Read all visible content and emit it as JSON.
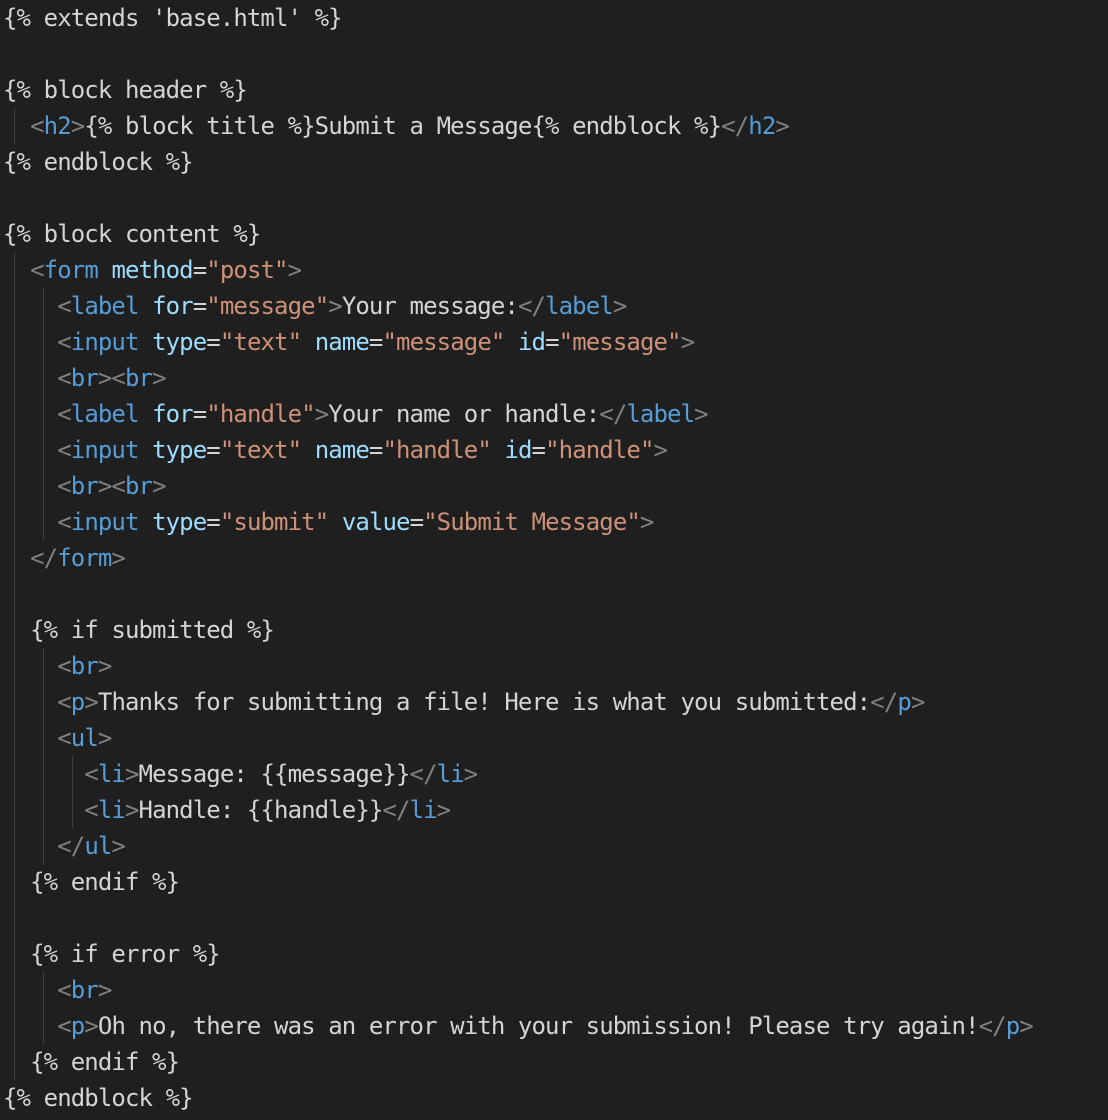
{
  "editor": {
    "colors": {
      "background": "#1f1f1f",
      "text": "#d4d4d4",
      "bracket": "#808080",
      "tag": "#569cd6",
      "attribute": "#9cdcfe",
      "string": "#ce9178",
      "indent_guide": "#3f3f3f"
    },
    "lines": [
      [
        {
          "t": "{% extends 'base.html' %}",
          "k": "text"
        }
      ],
      [],
      [
        {
          "t": "{% block header %}",
          "k": "text"
        }
      ],
      [
        {
          "t": "  ",
          "k": "text"
        },
        {
          "t": "<",
          "k": "bracket"
        },
        {
          "t": "h2",
          "k": "tag"
        },
        {
          "t": ">",
          "k": "bracket"
        },
        {
          "t": "{% block title %}Submit a Message{% endblock %}",
          "k": "text"
        },
        {
          "t": "</",
          "k": "bracket"
        },
        {
          "t": "h2",
          "k": "tag"
        },
        {
          "t": ">",
          "k": "bracket"
        }
      ],
      [
        {
          "t": "{% endblock %}",
          "k": "text"
        }
      ],
      [],
      [
        {
          "t": "{% block content %}",
          "k": "text"
        }
      ],
      [
        {
          "t": "  ",
          "k": "text"
        },
        {
          "t": "<",
          "k": "bracket"
        },
        {
          "t": "form",
          "k": "tag"
        },
        {
          "t": " ",
          "k": "text"
        },
        {
          "t": "method",
          "k": "attr"
        },
        {
          "t": "=",
          "k": "text"
        },
        {
          "t": "\"post\"",
          "k": "string"
        },
        {
          "t": ">",
          "k": "bracket"
        }
      ],
      [
        {
          "t": "    ",
          "k": "text"
        },
        {
          "t": "<",
          "k": "bracket"
        },
        {
          "t": "label",
          "k": "tag"
        },
        {
          "t": " ",
          "k": "text"
        },
        {
          "t": "for",
          "k": "attr"
        },
        {
          "t": "=",
          "k": "text"
        },
        {
          "t": "\"message\"",
          "k": "string"
        },
        {
          "t": ">",
          "k": "bracket"
        },
        {
          "t": "Your message:",
          "k": "text"
        },
        {
          "t": "</",
          "k": "bracket"
        },
        {
          "t": "label",
          "k": "tag"
        },
        {
          "t": ">",
          "k": "bracket"
        }
      ],
      [
        {
          "t": "    ",
          "k": "text"
        },
        {
          "t": "<",
          "k": "bracket"
        },
        {
          "t": "input",
          "k": "tag"
        },
        {
          "t": " ",
          "k": "text"
        },
        {
          "t": "type",
          "k": "attr"
        },
        {
          "t": "=",
          "k": "text"
        },
        {
          "t": "\"text\"",
          "k": "string"
        },
        {
          "t": " ",
          "k": "text"
        },
        {
          "t": "name",
          "k": "attr"
        },
        {
          "t": "=",
          "k": "text"
        },
        {
          "t": "\"message\"",
          "k": "string"
        },
        {
          "t": " ",
          "k": "text"
        },
        {
          "t": "id",
          "k": "attr"
        },
        {
          "t": "=",
          "k": "text"
        },
        {
          "t": "\"message\"",
          "k": "string"
        },
        {
          "t": ">",
          "k": "bracket"
        }
      ],
      [
        {
          "t": "    ",
          "k": "text"
        },
        {
          "t": "<",
          "k": "bracket"
        },
        {
          "t": "br",
          "k": "tag"
        },
        {
          "t": "><",
          "k": "bracket"
        },
        {
          "t": "br",
          "k": "tag"
        },
        {
          "t": ">",
          "k": "bracket"
        }
      ],
      [
        {
          "t": "    ",
          "k": "text"
        },
        {
          "t": "<",
          "k": "bracket"
        },
        {
          "t": "label",
          "k": "tag"
        },
        {
          "t": " ",
          "k": "text"
        },
        {
          "t": "for",
          "k": "attr"
        },
        {
          "t": "=",
          "k": "text"
        },
        {
          "t": "\"handle\"",
          "k": "string"
        },
        {
          "t": ">",
          "k": "bracket"
        },
        {
          "t": "Your name or handle:",
          "k": "text"
        },
        {
          "t": "</",
          "k": "bracket"
        },
        {
          "t": "label",
          "k": "tag"
        },
        {
          "t": ">",
          "k": "bracket"
        }
      ],
      [
        {
          "t": "    ",
          "k": "text"
        },
        {
          "t": "<",
          "k": "bracket"
        },
        {
          "t": "input",
          "k": "tag"
        },
        {
          "t": " ",
          "k": "text"
        },
        {
          "t": "type",
          "k": "attr"
        },
        {
          "t": "=",
          "k": "text"
        },
        {
          "t": "\"text\"",
          "k": "string"
        },
        {
          "t": " ",
          "k": "text"
        },
        {
          "t": "name",
          "k": "attr"
        },
        {
          "t": "=",
          "k": "text"
        },
        {
          "t": "\"handle\"",
          "k": "string"
        },
        {
          "t": " ",
          "k": "text"
        },
        {
          "t": "id",
          "k": "attr"
        },
        {
          "t": "=",
          "k": "text"
        },
        {
          "t": "\"handle\"",
          "k": "string"
        },
        {
          "t": ">",
          "k": "bracket"
        }
      ],
      [
        {
          "t": "    ",
          "k": "text"
        },
        {
          "t": "<",
          "k": "bracket"
        },
        {
          "t": "br",
          "k": "tag"
        },
        {
          "t": "><",
          "k": "bracket"
        },
        {
          "t": "br",
          "k": "tag"
        },
        {
          "t": ">",
          "k": "bracket"
        }
      ],
      [
        {
          "t": "    ",
          "k": "text"
        },
        {
          "t": "<",
          "k": "bracket"
        },
        {
          "t": "input",
          "k": "tag"
        },
        {
          "t": " ",
          "k": "text"
        },
        {
          "t": "type",
          "k": "attr"
        },
        {
          "t": "=",
          "k": "text"
        },
        {
          "t": "\"submit\"",
          "k": "string"
        },
        {
          "t": " ",
          "k": "text"
        },
        {
          "t": "value",
          "k": "attr"
        },
        {
          "t": "=",
          "k": "text"
        },
        {
          "t": "\"Submit Message\"",
          "k": "string"
        },
        {
          "t": ">",
          "k": "bracket"
        }
      ],
      [
        {
          "t": "  ",
          "k": "text"
        },
        {
          "t": "</",
          "k": "bracket"
        },
        {
          "t": "form",
          "k": "tag"
        },
        {
          "t": ">",
          "k": "bracket"
        }
      ],
      [],
      [
        {
          "t": "  {% if submitted %}",
          "k": "text"
        }
      ],
      [
        {
          "t": "    ",
          "k": "text"
        },
        {
          "t": "<",
          "k": "bracket"
        },
        {
          "t": "br",
          "k": "tag"
        },
        {
          "t": ">",
          "k": "bracket"
        }
      ],
      [
        {
          "t": "    ",
          "k": "text"
        },
        {
          "t": "<",
          "k": "bracket"
        },
        {
          "t": "p",
          "k": "tag"
        },
        {
          "t": ">",
          "k": "bracket"
        },
        {
          "t": "Thanks for submitting a file! Here is what you submitted:",
          "k": "text"
        },
        {
          "t": "</",
          "k": "bracket"
        },
        {
          "t": "p",
          "k": "tag"
        },
        {
          "t": ">",
          "k": "bracket"
        }
      ],
      [
        {
          "t": "    ",
          "k": "text"
        },
        {
          "t": "<",
          "k": "bracket"
        },
        {
          "t": "ul",
          "k": "tag"
        },
        {
          "t": ">",
          "k": "bracket"
        }
      ],
      [
        {
          "t": "      ",
          "k": "text"
        },
        {
          "t": "<",
          "k": "bracket"
        },
        {
          "t": "li",
          "k": "tag"
        },
        {
          "t": ">",
          "k": "bracket"
        },
        {
          "t": "Message: {{message}}",
          "k": "text"
        },
        {
          "t": "</",
          "k": "bracket"
        },
        {
          "t": "li",
          "k": "tag"
        },
        {
          "t": ">",
          "k": "bracket"
        }
      ],
      [
        {
          "t": "      ",
          "k": "text"
        },
        {
          "t": "<",
          "k": "bracket"
        },
        {
          "t": "li",
          "k": "tag"
        },
        {
          "t": ">",
          "k": "bracket"
        },
        {
          "t": "Handle: {{handle}}",
          "k": "text"
        },
        {
          "t": "</",
          "k": "bracket"
        },
        {
          "t": "li",
          "k": "tag"
        },
        {
          "t": ">",
          "k": "bracket"
        }
      ],
      [
        {
          "t": "    ",
          "k": "text"
        },
        {
          "t": "</",
          "k": "bracket"
        },
        {
          "t": "ul",
          "k": "tag"
        },
        {
          "t": ">",
          "k": "bracket"
        }
      ],
      [
        {
          "t": "  {% endif %}",
          "k": "text"
        }
      ],
      [],
      [
        {
          "t": "  {% if error %}",
          "k": "text"
        }
      ],
      [
        {
          "t": "    ",
          "k": "text"
        },
        {
          "t": "<",
          "k": "bracket"
        },
        {
          "t": "br",
          "k": "tag"
        },
        {
          "t": ">",
          "k": "bracket"
        }
      ],
      [
        {
          "t": "    ",
          "k": "text"
        },
        {
          "t": "<",
          "k": "bracket"
        },
        {
          "t": "p",
          "k": "tag"
        },
        {
          "t": ">",
          "k": "bracket"
        },
        {
          "t": "Oh no, there was an error with your submission! Please try again!",
          "k": "text"
        },
        {
          "t": "</",
          "k": "bracket"
        },
        {
          "t": "p",
          "k": "tag"
        },
        {
          "t": ">",
          "k": "bracket"
        }
      ],
      [
        {
          "t": "  {% endif %}",
          "k": "text"
        }
      ],
      [
        {
          "t": "{% endblock %}",
          "k": "text"
        }
      ]
    ]
  }
}
